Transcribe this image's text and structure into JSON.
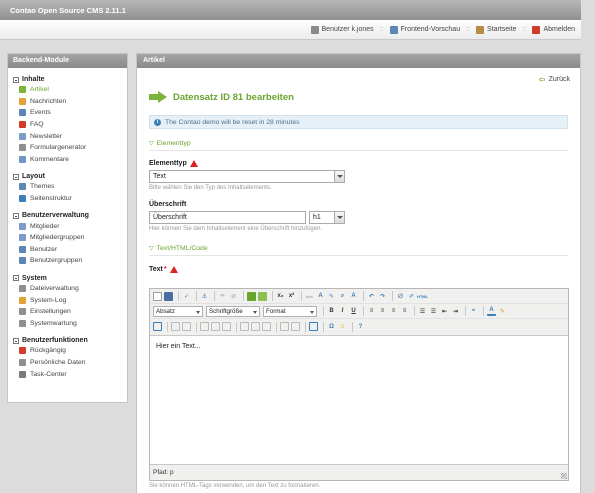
{
  "app": {
    "title": "Contao Open Source CMS 2.11.1"
  },
  "user_bar": [
    {
      "icon": "user-icon",
      "label": "Benutzer k.jones",
      "color": "#8a8a8a"
    },
    {
      "icon": "frontend-preview-icon",
      "label": "Frontend-Vorschau",
      "color": "#5b86b5"
    },
    {
      "icon": "home-icon",
      "label": "Startseite",
      "color": "#b58b4b"
    },
    {
      "icon": "logout-icon",
      "label": "Abmelden",
      "color": "#d23a2a"
    }
  ],
  "sidebar": {
    "title": "Backend-Module",
    "groups": [
      {
        "title": "Inhalte",
        "items": [
          {
            "label": "Artikel",
            "icon": "article-icon",
            "color": "#7bb33b",
            "active": true
          },
          {
            "label": "Nachrichten",
            "icon": "news-icon",
            "color": "#e2a33a"
          },
          {
            "label": "Events",
            "icon": "events-icon",
            "color": "#5b86b5"
          },
          {
            "label": "FAQ",
            "icon": "faq-icon",
            "color": "#d23a2a"
          },
          {
            "label": "Newsletter",
            "icon": "newsletter-icon",
            "color": "#7a9cc6"
          },
          {
            "label": "Formulargenerator",
            "icon": "form-generator-icon",
            "color": "#8f8f8f"
          },
          {
            "label": "Kommentare",
            "icon": "comments-icon",
            "color": "#6f96c4"
          }
        ]
      },
      {
        "title": "Layout",
        "items": [
          {
            "label": "Themes",
            "icon": "themes-icon",
            "color": "#5b86b5"
          },
          {
            "label": "Seitenstruktur",
            "icon": "site-structure-icon",
            "color": "#3d7fb9"
          }
        ]
      },
      {
        "title": "Benutzerverwaltung",
        "items": [
          {
            "label": "Mitglieder",
            "icon": "members-icon",
            "color": "#7a9cc6"
          },
          {
            "label": "Mitgliedergruppen",
            "icon": "member-groups-icon",
            "color": "#7a9cc6"
          },
          {
            "label": "Benutzer",
            "icon": "users-icon",
            "color": "#5b86b5"
          },
          {
            "label": "Benutzergruppen",
            "icon": "user-groups-icon",
            "color": "#5b86b5"
          }
        ]
      },
      {
        "title": "System",
        "items": [
          {
            "label": "Dateiverwaltung",
            "icon": "file-manager-icon",
            "color": "#8f8f8f"
          },
          {
            "label": "System-Log",
            "icon": "system-log-icon",
            "color": "#e2a33a"
          },
          {
            "label": "Einstellungen",
            "icon": "settings-icon",
            "color": "#8f8f8f"
          },
          {
            "label": "Systemwartung",
            "icon": "maintenance-icon",
            "color": "#8f8f8f"
          }
        ]
      },
      {
        "title": "Benutzerfunktionen",
        "items": [
          {
            "label": "Rückgängig",
            "icon": "undo-icon",
            "color": "#d23a2a"
          },
          {
            "label": "Persönliche Daten",
            "icon": "personal-data-icon",
            "color": "#8f8f8f"
          },
          {
            "label": "Task-Center",
            "icon": "task-center-icon",
            "color": "#7a7a7a"
          }
        ]
      }
    ]
  },
  "main": {
    "panel_title": "Artikel",
    "back_label": "Zurück",
    "heading": "Datensatz ID 81 bearbeiten",
    "info": "The Contao demo will be reset in 28 minutes",
    "legend_type": "Elementtyp",
    "type_label": "Elementtyp",
    "type_value": "Text",
    "type_hint": "Bitte wählen Sie den Typ des Inhaltselements.",
    "headline_label": "Überschrift",
    "headline_value": "Überschrift",
    "headline_tag": "h1",
    "headline_hint": "Hier können Sie dem Inhaltselement eine Überschrift hinzufügen.",
    "legend_text": "Text/HTML/Code",
    "text_label": "Text",
    "editor": {
      "format_select": "Absatz",
      "size_select": "Schriftgröße",
      "style_select": "Format",
      "content": "Hier ein Text...",
      "path": "Pfad: p"
    },
    "text_hint": "Sie können HTML-Tags verwenden, um den Text zu formatieren."
  },
  "accent_color": "#6aa52e"
}
